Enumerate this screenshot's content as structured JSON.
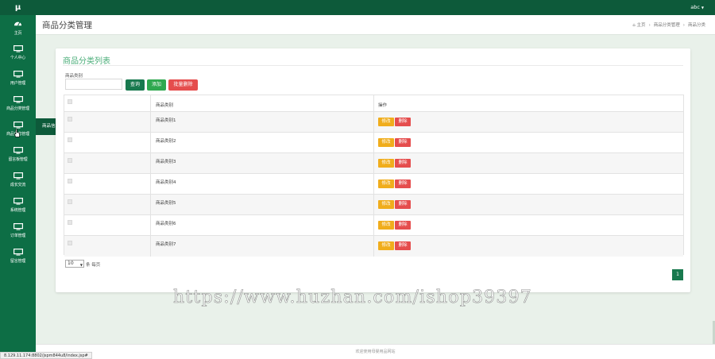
{
  "app": {
    "logo": "μ",
    "user": "abc",
    "brand_color": "#0d6e45",
    "header_color": "#0d5a3a"
  },
  "sidebar": {
    "items": [
      {
        "label": "主页",
        "icon": "dashboard-icon"
      },
      {
        "label": "个人中心",
        "icon": "monitor-icon"
      },
      {
        "label": "用户管理",
        "icon": "monitor-icon"
      },
      {
        "label": "商品分类管理",
        "icon": "monitor-icon"
      },
      {
        "label": "商品信息管理",
        "icon": "monitor-icon"
      },
      {
        "label": "留言板管理",
        "icon": "monitor-icon"
      },
      {
        "label": "成长交流",
        "icon": "monitor-icon"
      },
      {
        "label": "系统管理",
        "icon": "monitor-icon"
      },
      {
        "label": "订单管理",
        "icon": "monitor-icon"
      },
      {
        "label": "留言管理",
        "icon": "monitor-icon"
      }
    ],
    "flyout": {
      "label": "商品信息"
    }
  },
  "header": {
    "title": "商品分类管理",
    "breadcrumb": [
      "主页",
      "商品分类管理",
      "商品分类"
    ]
  },
  "card": {
    "title": "商品分类列表",
    "filter_label": "商品类别",
    "filter_value": "",
    "buttons": {
      "query": "查询",
      "add": "添加",
      "batch_delete": "批量删除"
    }
  },
  "table": {
    "headers": {
      "name": "商品类别",
      "ops": "操作"
    },
    "rows": [
      {
        "name": "商品类别1"
      },
      {
        "name": "商品类别2"
      },
      {
        "name": "商品类别3"
      },
      {
        "name": "商品类别4"
      },
      {
        "name": "商品类别5"
      },
      {
        "name": "商品类别6"
      },
      {
        "name": "商品类别7"
      }
    ],
    "op_labels": {
      "edit": "修改",
      "delete": "删除"
    }
  },
  "pagination": {
    "page_size": "10",
    "per_page_label": "条 每页",
    "current_page": "1"
  },
  "watermark": "https://www.huzhan.com/ishop39397",
  "footer": {
    "text": "欢迎使用母婴用品网站"
  },
  "statusbar": {
    "url": "8.129.11.174:8802/jspm844u8/index.jsp#"
  }
}
